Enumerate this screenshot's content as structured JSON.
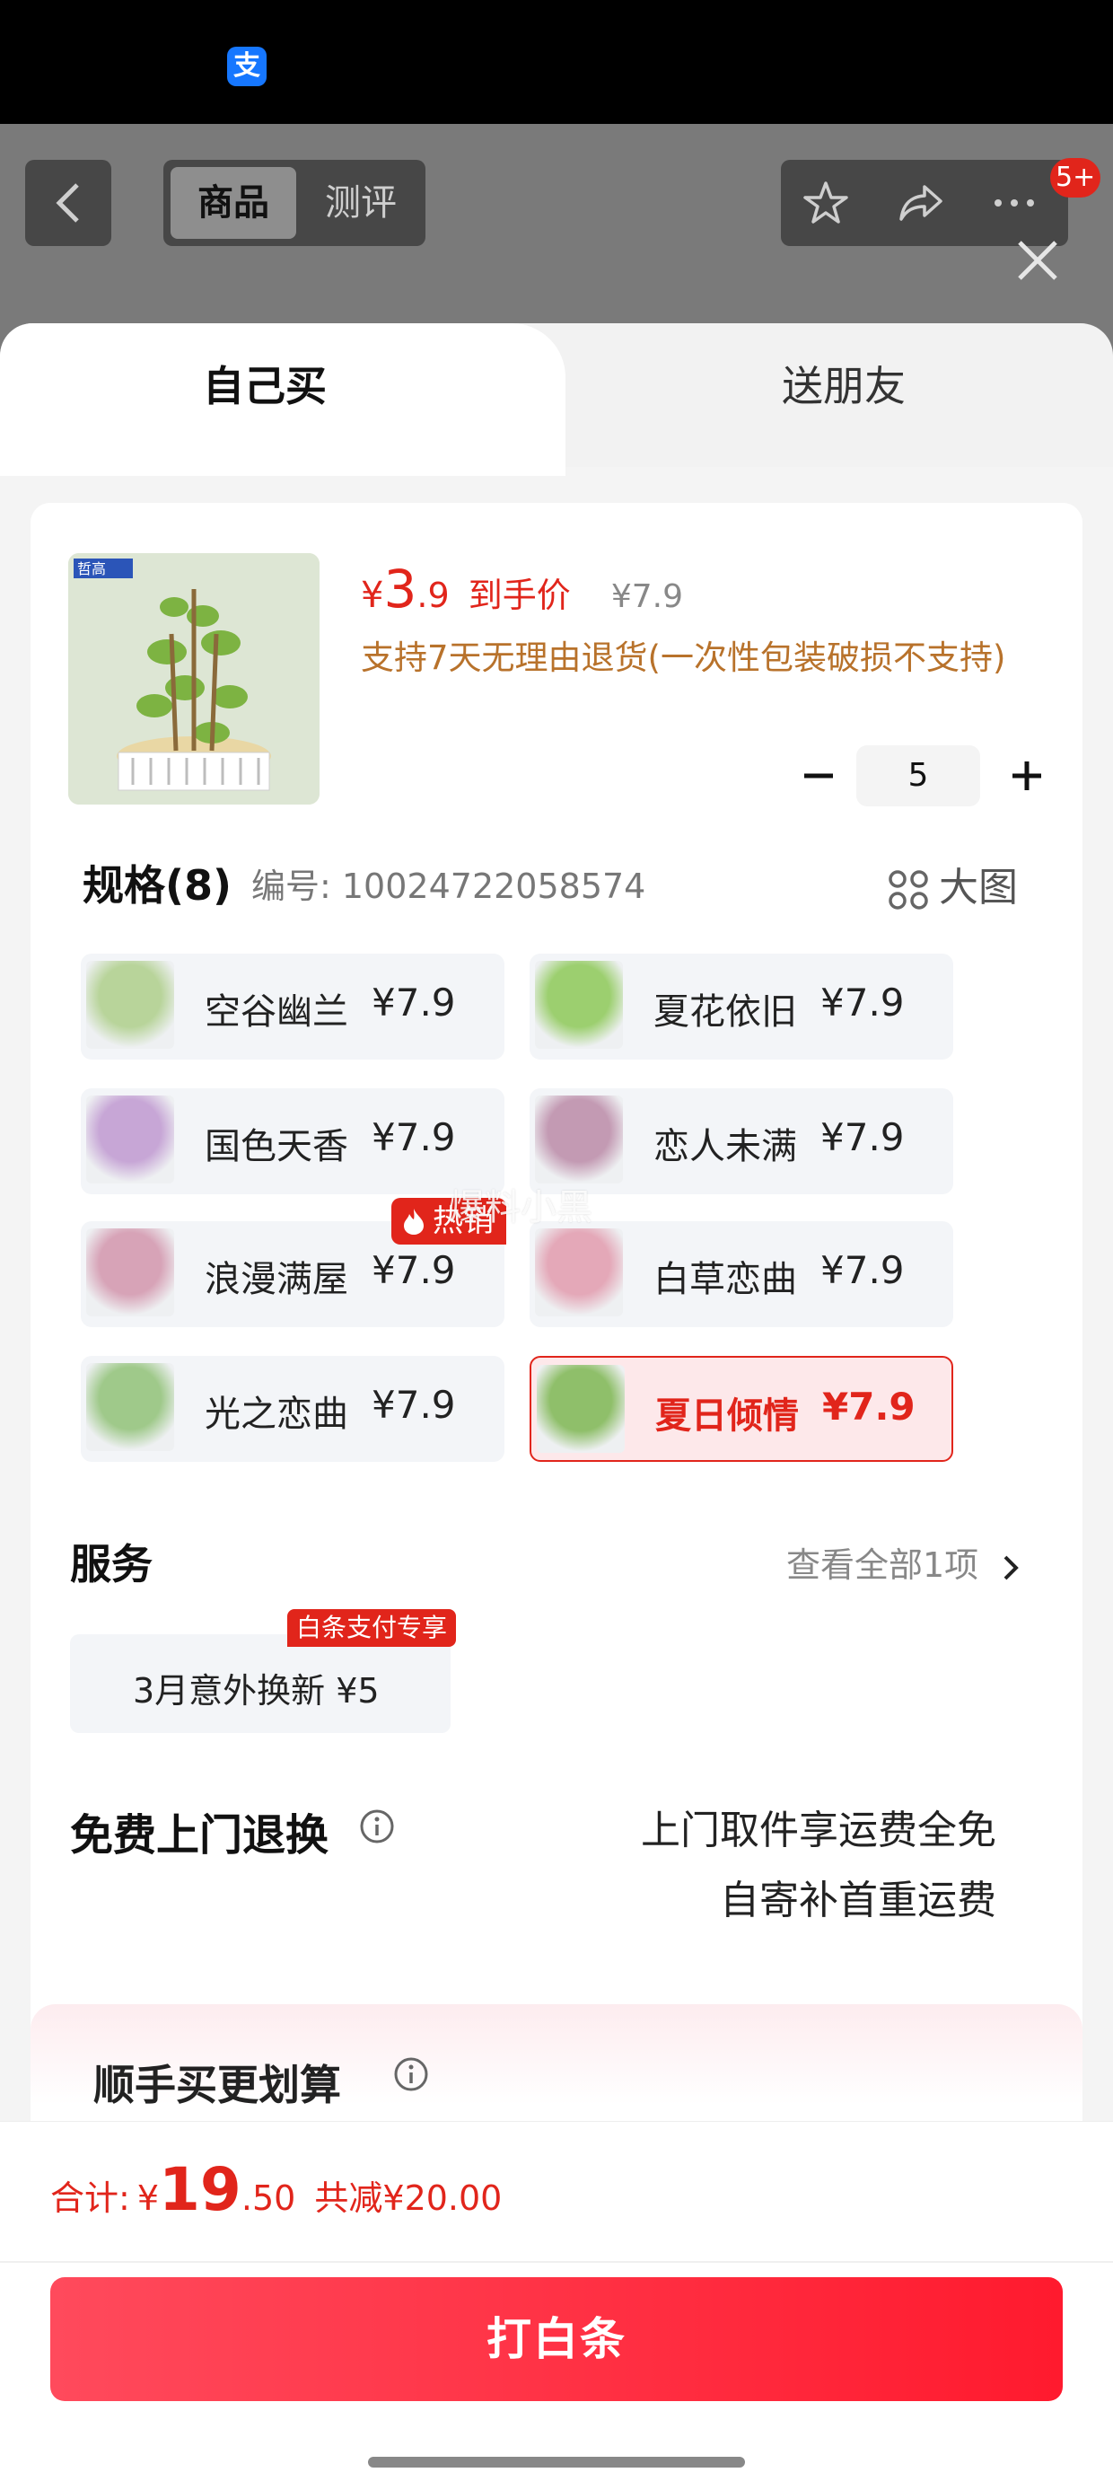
{
  "status": {
    "app_icon_glyph": "支"
  },
  "background_page": {
    "tabs": [
      "商品",
      "测评"
    ],
    "message_badge": "5+"
  },
  "sheet": {
    "tabs": {
      "self_buy": "自己买",
      "gift": "送朋友"
    },
    "product": {
      "price_symbol": "¥",
      "price_integer": "3",
      "price_decimal": ".9",
      "price_label": "到手价",
      "original_price": "¥7.9",
      "return_note": "支持7天无理由退货(一次性包装破损不支持)",
      "quantity": "5",
      "brand_badge": "哲高"
    },
    "spec": {
      "title": "规格(8)",
      "code": "编号: 10024722058574",
      "big_view": "大图",
      "items": [
        {
          "name": "空谷幽兰",
          "price": "¥7.9",
          "color": "#b8d49a"
        },
        {
          "name": "夏花依旧",
          "price": "¥7.9",
          "color": "#9ccf6f"
        },
        {
          "name": "国色天香",
          "price": "¥7.9",
          "color": "#c7a6d6"
        },
        {
          "name": "恋人未满",
          "price": "¥7.9",
          "color": "#c39ab3"
        },
        {
          "name": "浪漫满屋",
          "price": "¥7.9",
          "color": "#d7a3b7"
        },
        {
          "name": "白草恋曲",
          "price": "¥7.9",
          "color": "#e4a8b8"
        },
        {
          "name": "光之恋曲",
          "price": "¥7.9",
          "color": "#9fc98a"
        },
        {
          "name": "夏日倾情",
          "price": "¥7.9",
          "color": "#8fbf6a",
          "selected": true
        }
      ],
      "hot_tag": "热销",
      "watermark": "爆料小黑"
    },
    "service": {
      "title": "服务",
      "view_all": "查看全部1项",
      "option": "3月意外换新  ¥5",
      "option_tag": "白条支付专享"
    },
    "door_return": {
      "title": "免费上门退换",
      "line1": "上门取件享运费全免",
      "line2": "自寄补首重运费"
    },
    "extra": {
      "title": "顺手买更划算"
    }
  },
  "footer": {
    "total_label": "合计:",
    "total_symbol": "¥",
    "total_integer": "19",
    "total_decimal": ".50",
    "discount": "共减¥20.00",
    "pay_button": "打白条"
  },
  "colors": {
    "accent": "#e1251b",
    "note": "#b8722b"
  }
}
